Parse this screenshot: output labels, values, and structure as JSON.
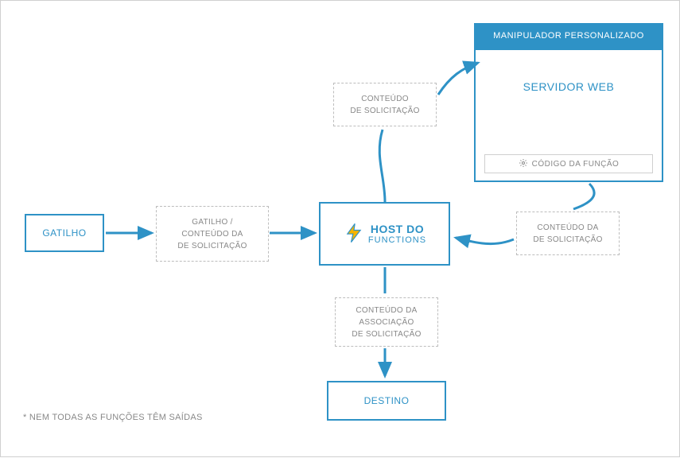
{
  "nodes": {
    "trigger_box": "GATILHO",
    "trigger_payload": {
      "l1": "GATILHO  /",
      "l2": "CONTEÚDO DA",
      "l3": "DE SOLICITAÇÃO"
    },
    "functions_host": {
      "l1": "HOST DO",
      "l2": "FUNCTIONS"
    },
    "request_payload_top": {
      "l1": "CONTEÚDO",
      "l2": "DE SOLICITAÇÃO"
    },
    "custom_handler_header": "MANIPULADOR PERSONALIZADO",
    "web_server": "SERVIDOR WEB",
    "function_code": "CÓDIGO DA FUNÇÃO",
    "response_payload_right": {
      "l1": "CONTEÚDO DA",
      "l2": "DE SOLICITAÇÃO"
    },
    "binding_payload_bottom": {
      "l1": "CONTEÚDO DA",
      "l2": "ASSOCIAÇÃO",
      "l3": "DE SOLICITAÇÃO"
    },
    "destination": "DESTINO"
  },
  "footnote": "*  NEM TODAS AS FUNÇÕES TÊM SAÍDAS",
  "colors": {
    "primary": "#2e92c6",
    "muted": "#888",
    "dash": "#bdbdbd"
  },
  "icons": {
    "lightning": "lightning-icon",
    "gear": "gear-icon"
  }
}
